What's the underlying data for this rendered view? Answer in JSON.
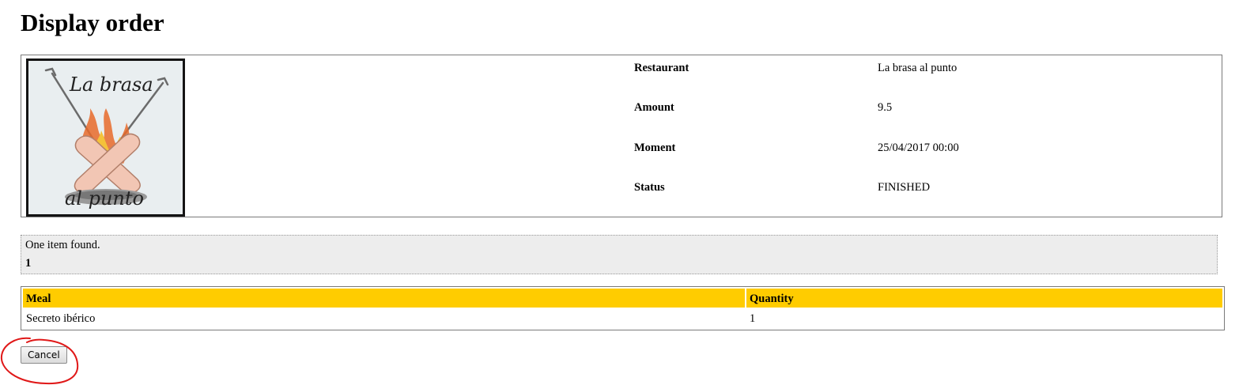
{
  "page": {
    "title": "Display order"
  },
  "order": {
    "logo_alt": "La brasa al punto",
    "logo_text_top": "La brasa",
    "logo_text_bottom": "al punto",
    "details": [
      {
        "label": "Restaurant",
        "value": "La brasa al punto"
      },
      {
        "label": "Amount",
        "value": "9.5"
      },
      {
        "label": "Moment",
        "value": "25/04/2017 00:00"
      },
      {
        "label": "Status",
        "value": "FINISHED"
      }
    ]
  },
  "results": {
    "summary": "One item found.",
    "current_page": "1"
  },
  "meals_table": {
    "headers": [
      "Meal",
      "Quantity"
    ],
    "rows": [
      [
        "Secreto ibérico",
        "1"
      ]
    ],
    "header_color": "#ffcc00"
  },
  "actions": {
    "cancel_label": "Cancel"
  },
  "annotation": {
    "color": "#e01818",
    "shape": "hand-drawn circle around cancel button"
  }
}
